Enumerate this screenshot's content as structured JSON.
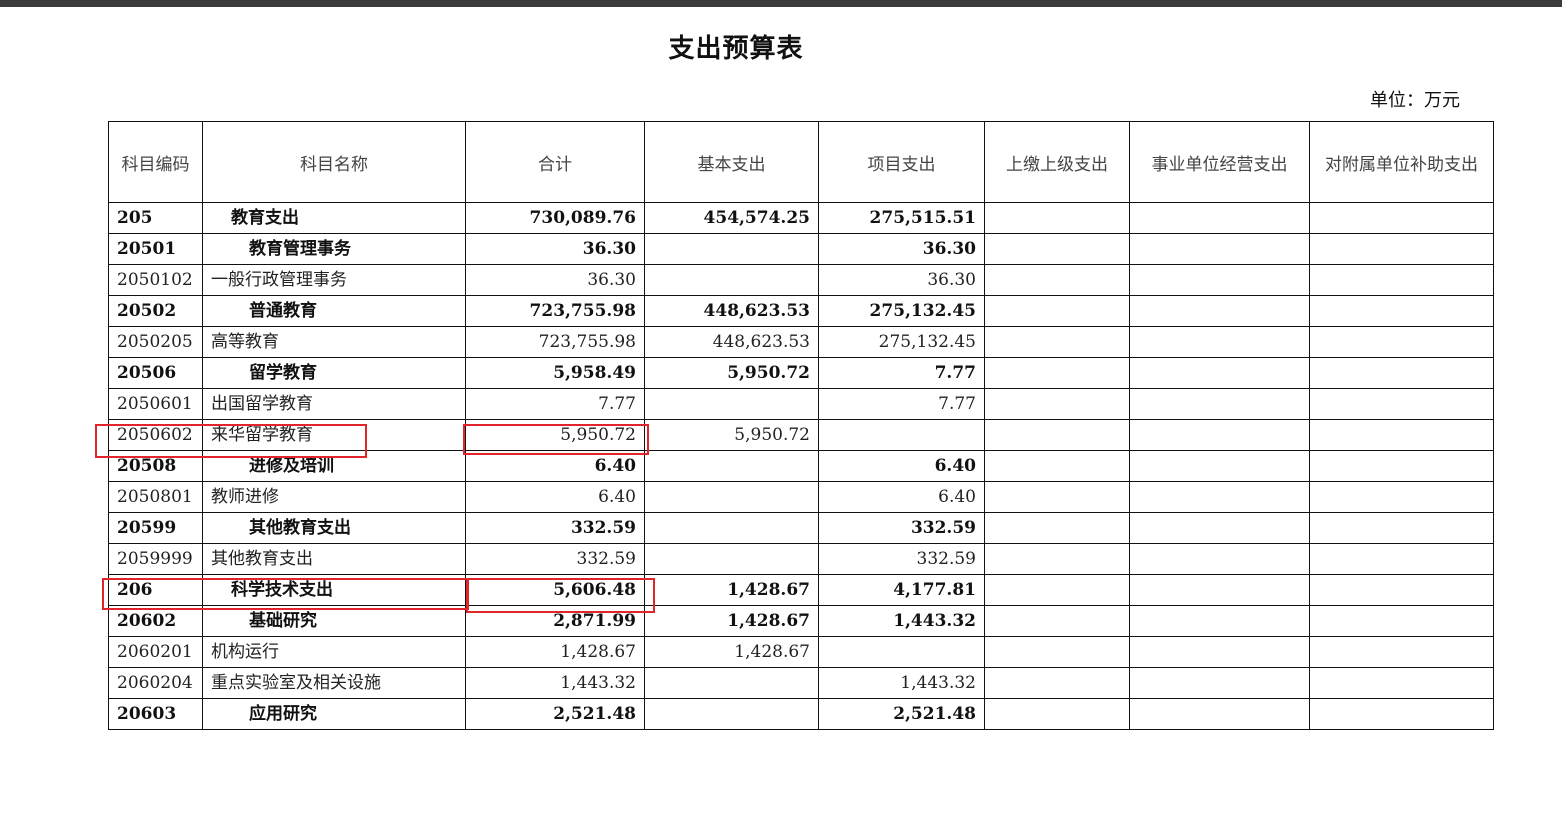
{
  "document": {
    "title": "支出预算表",
    "unit": "单位：万元"
  },
  "table": {
    "headers": [
      "科目编码",
      "科目名称",
      "合计",
      "基本支出",
      "项目支出",
      "上缴上级支出",
      "事业单位经营支出",
      "对附属单位补助支出"
    ],
    "rows": [
      {
        "code": "205",
        "name": "教育支出",
        "total": "730,089.76",
        "basic": "454,574.25",
        "project": "275,515.51",
        "upper": "",
        "business": "",
        "subsidy": "",
        "level": 1
      },
      {
        "code": "20501",
        "name": "教育管理事务",
        "total": "36.30",
        "basic": "",
        "project": "36.30",
        "upper": "",
        "business": "",
        "subsidy": "",
        "level": 2
      },
      {
        "code": "2050102",
        "name": "一般行政管理事务",
        "total": "36.30",
        "basic": "",
        "project": "36.30",
        "upper": "",
        "business": "",
        "subsidy": "",
        "level": 3
      },
      {
        "code": "20502",
        "name": "普通教育",
        "total": "723,755.98",
        "basic": "448,623.53",
        "project": "275,132.45",
        "upper": "",
        "business": "",
        "subsidy": "",
        "level": 2
      },
      {
        "code": "2050205",
        "name": "高等教育",
        "total": "723,755.98",
        "basic": "448,623.53",
        "project": "275,132.45",
        "upper": "",
        "business": "",
        "subsidy": "",
        "level": 3
      },
      {
        "code": "20506",
        "name": "留学教育",
        "total": "5,958.49",
        "basic": "5,950.72",
        "project": "7.77",
        "upper": "",
        "business": "",
        "subsidy": "",
        "level": 2
      },
      {
        "code": "2050601",
        "name": "出国留学教育",
        "total": "7.77",
        "basic": "",
        "project": "7.77",
        "upper": "",
        "business": "",
        "subsidy": "",
        "level": 3
      },
      {
        "code": "2050602",
        "name": "来华留学教育",
        "total": "5,950.72",
        "basic": "5,950.72",
        "project": "",
        "upper": "",
        "business": "",
        "subsidy": "",
        "level": 3
      },
      {
        "code": "20508",
        "name": "进修及培训",
        "total": "6.40",
        "basic": "",
        "project": "6.40",
        "upper": "",
        "business": "",
        "subsidy": "",
        "level": 2
      },
      {
        "code": "2050801",
        "name": "教师进修",
        "total": "6.40",
        "basic": "",
        "project": "6.40",
        "upper": "",
        "business": "",
        "subsidy": "",
        "level": 3
      },
      {
        "code": "20599",
        "name": "其他教育支出",
        "total": "332.59",
        "basic": "",
        "project": "332.59",
        "upper": "",
        "business": "",
        "subsidy": "",
        "level": 2
      },
      {
        "code": "2059999",
        "name": "其他教育支出",
        "total": "332.59",
        "basic": "",
        "project": "332.59",
        "upper": "",
        "business": "",
        "subsidy": "",
        "level": 3
      },
      {
        "code": "206",
        "name": "科学技术支出",
        "total": "5,606.48",
        "basic": "1,428.67",
        "project": "4,177.81",
        "upper": "",
        "business": "",
        "subsidy": "",
        "level": 1
      },
      {
        "code": "20602",
        "name": "基础研究",
        "total": "2,871.99",
        "basic": "1,428.67",
        "project": "1,443.32",
        "upper": "",
        "business": "",
        "subsidy": "",
        "level": 2
      },
      {
        "code": "2060201",
        "name": "机构运行",
        "total": "1,428.67",
        "basic": "1,428.67",
        "project": "",
        "upper": "",
        "business": "",
        "subsidy": "",
        "level": 3
      },
      {
        "code": "2060204",
        "name": "重点实验室及相关设施",
        "total": "1,443.32",
        "basic": "",
        "project": "1,443.32",
        "upper": "",
        "business": "",
        "subsidy": "",
        "level": 3
      },
      {
        "code": "20603",
        "name": "应用研究",
        "total": "2,521.48",
        "basic": "",
        "project": "2,521.48",
        "upper": "",
        "business": "",
        "subsidy": "",
        "level": 2
      }
    ]
  },
  "annotations": {
    "highlight_color": "#e0262a"
  }
}
